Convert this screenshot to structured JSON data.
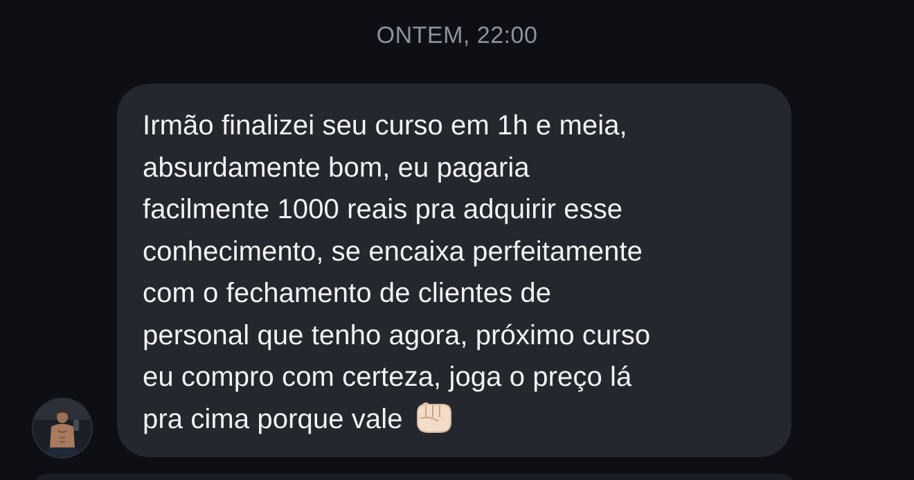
{
  "chat": {
    "timestamp": "ONTEM, 22:00",
    "message": {
      "lines": [
        "Irmão finalizei seu curso em 1h e meia,",
        "absurdamente bom, eu pagaria",
        "facilmente 1000 reais pra adquirir esse",
        "conhecimento, se encaixa perfeitamente",
        "com o fechamento de clientes de",
        "personal que tenho agora, próximo curso",
        "eu compro com certeza, joga o preço lá",
        "pra cima porque vale"
      ],
      "trailing_emoji": "fist-icon"
    }
  },
  "colors": {
    "background": "#0d0f14",
    "bubble": "#24272e",
    "text": "#f2f3f5",
    "timestamp": "#8d929c"
  }
}
